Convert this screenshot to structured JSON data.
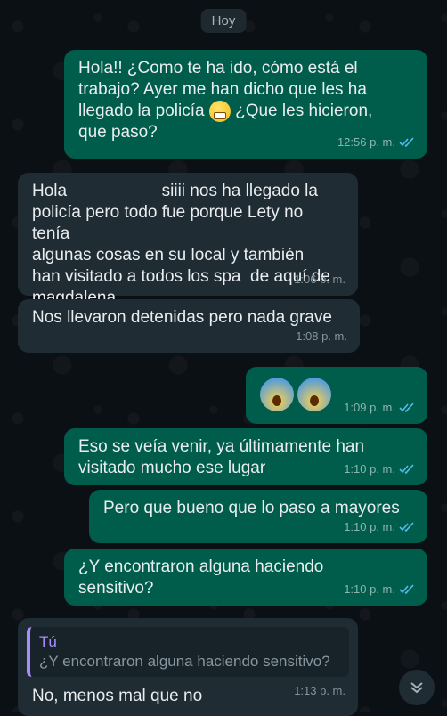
{
  "date_chip": "Hoy",
  "messages": [
    {
      "dir": "out",
      "text": "Hola!! ¿Como te ha ido, cómo está el\ntrabajo? Ayer me han dicho que les ha\nllegado la policía",
      "text2": " ¿Que les hicieron,\nque paso?",
      "time": "12:56 p. m.",
      "ticks": "read"
    },
    {
      "dir": "in",
      "text_a": "Hola",
      "text_b": "siiii nos ha llegado la\npolicía pero todo fue porque Lety no tenía\nalgunas cosas en su local y también\nhan visitado a todos los spa  de aquí de\nmagdalena",
      "time": "1:06 p. m."
    },
    {
      "dir": "in",
      "text": "Nos llevaron detenidas pero nada grave",
      "time": "1:08 p. m."
    },
    {
      "dir": "out",
      "emoji": "screaming-face x2",
      "time": "1:09 p. m.",
      "ticks": "read"
    },
    {
      "dir": "out",
      "text": "Eso se veía venir, ya últimamente han\nvisitado mucho ese lugar",
      "time": "1:10 p. m.",
      "ticks": "read"
    },
    {
      "dir": "out",
      "text": "Pero que bueno que lo paso a mayores",
      "time": "1:10 p. m.",
      "ticks": "read"
    },
    {
      "dir": "out",
      "text": "¿Y encontraron alguna haciendo\nsensitivo?",
      "time": "1:10 p. m.",
      "ticks": "read"
    },
    {
      "dir": "in",
      "quote_author": "Tú",
      "quote_text": "¿Y encontraron alguna haciendo sensitivo?",
      "text": "No, menos mal que no",
      "time": "1:13 p. m."
    }
  ],
  "colors": {
    "outgoing": "#005c4b",
    "incoming": "#1f2c34",
    "read_tick": "#53bdeb",
    "quote_accent": "#a68fff"
  },
  "icons": {
    "read_ticks": "double-check-icon",
    "scroll": "chevron-double-down-icon"
  }
}
